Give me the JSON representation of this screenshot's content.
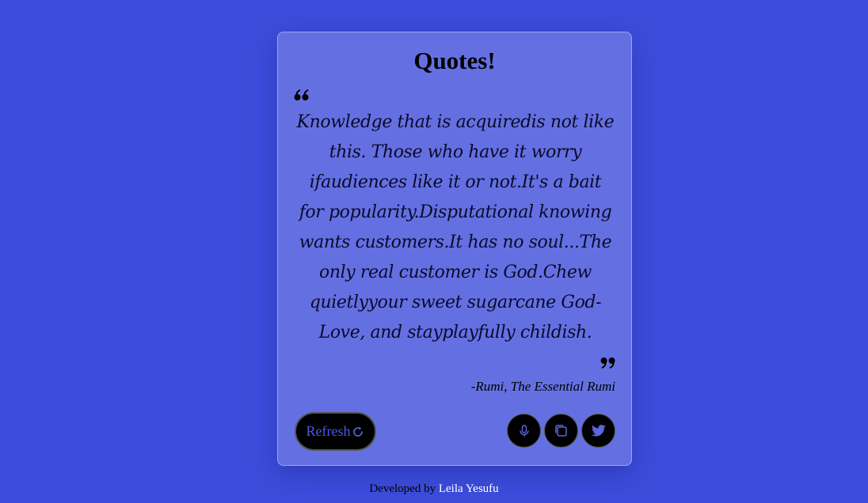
{
  "card": {
    "title": "Quotes!",
    "quote_text": "Knowledge that is acquiredis not like this. Those who have it worry ifaudiences like it or not.It's a bait for popularity.Disputational knowing wants customers.It has no soul...The only real customer is God.Chew quietlyyour sweet sugarcane God-Love, and stayplayfully childish.",
    "author": "-Rumi, The Essential Rumi",
    "refresh_label": "Refresh"
  },
  "buttons": {
    "icons": [
      "refresh-icon",
      "microphone-icon",
      "copy-icon",
      "twitter-icon"
    ]
  },
  "footer": {
    "prefix": "Developed by",
    "name": "Leila Yesufu"
  },
  "colors": {
    "background": "#3c4ddb",
    "card": "#6470e2",
    "button": "#000000",
    "button_text": "#4b59e6",
    "icon": "#5b67df"
  }
}
